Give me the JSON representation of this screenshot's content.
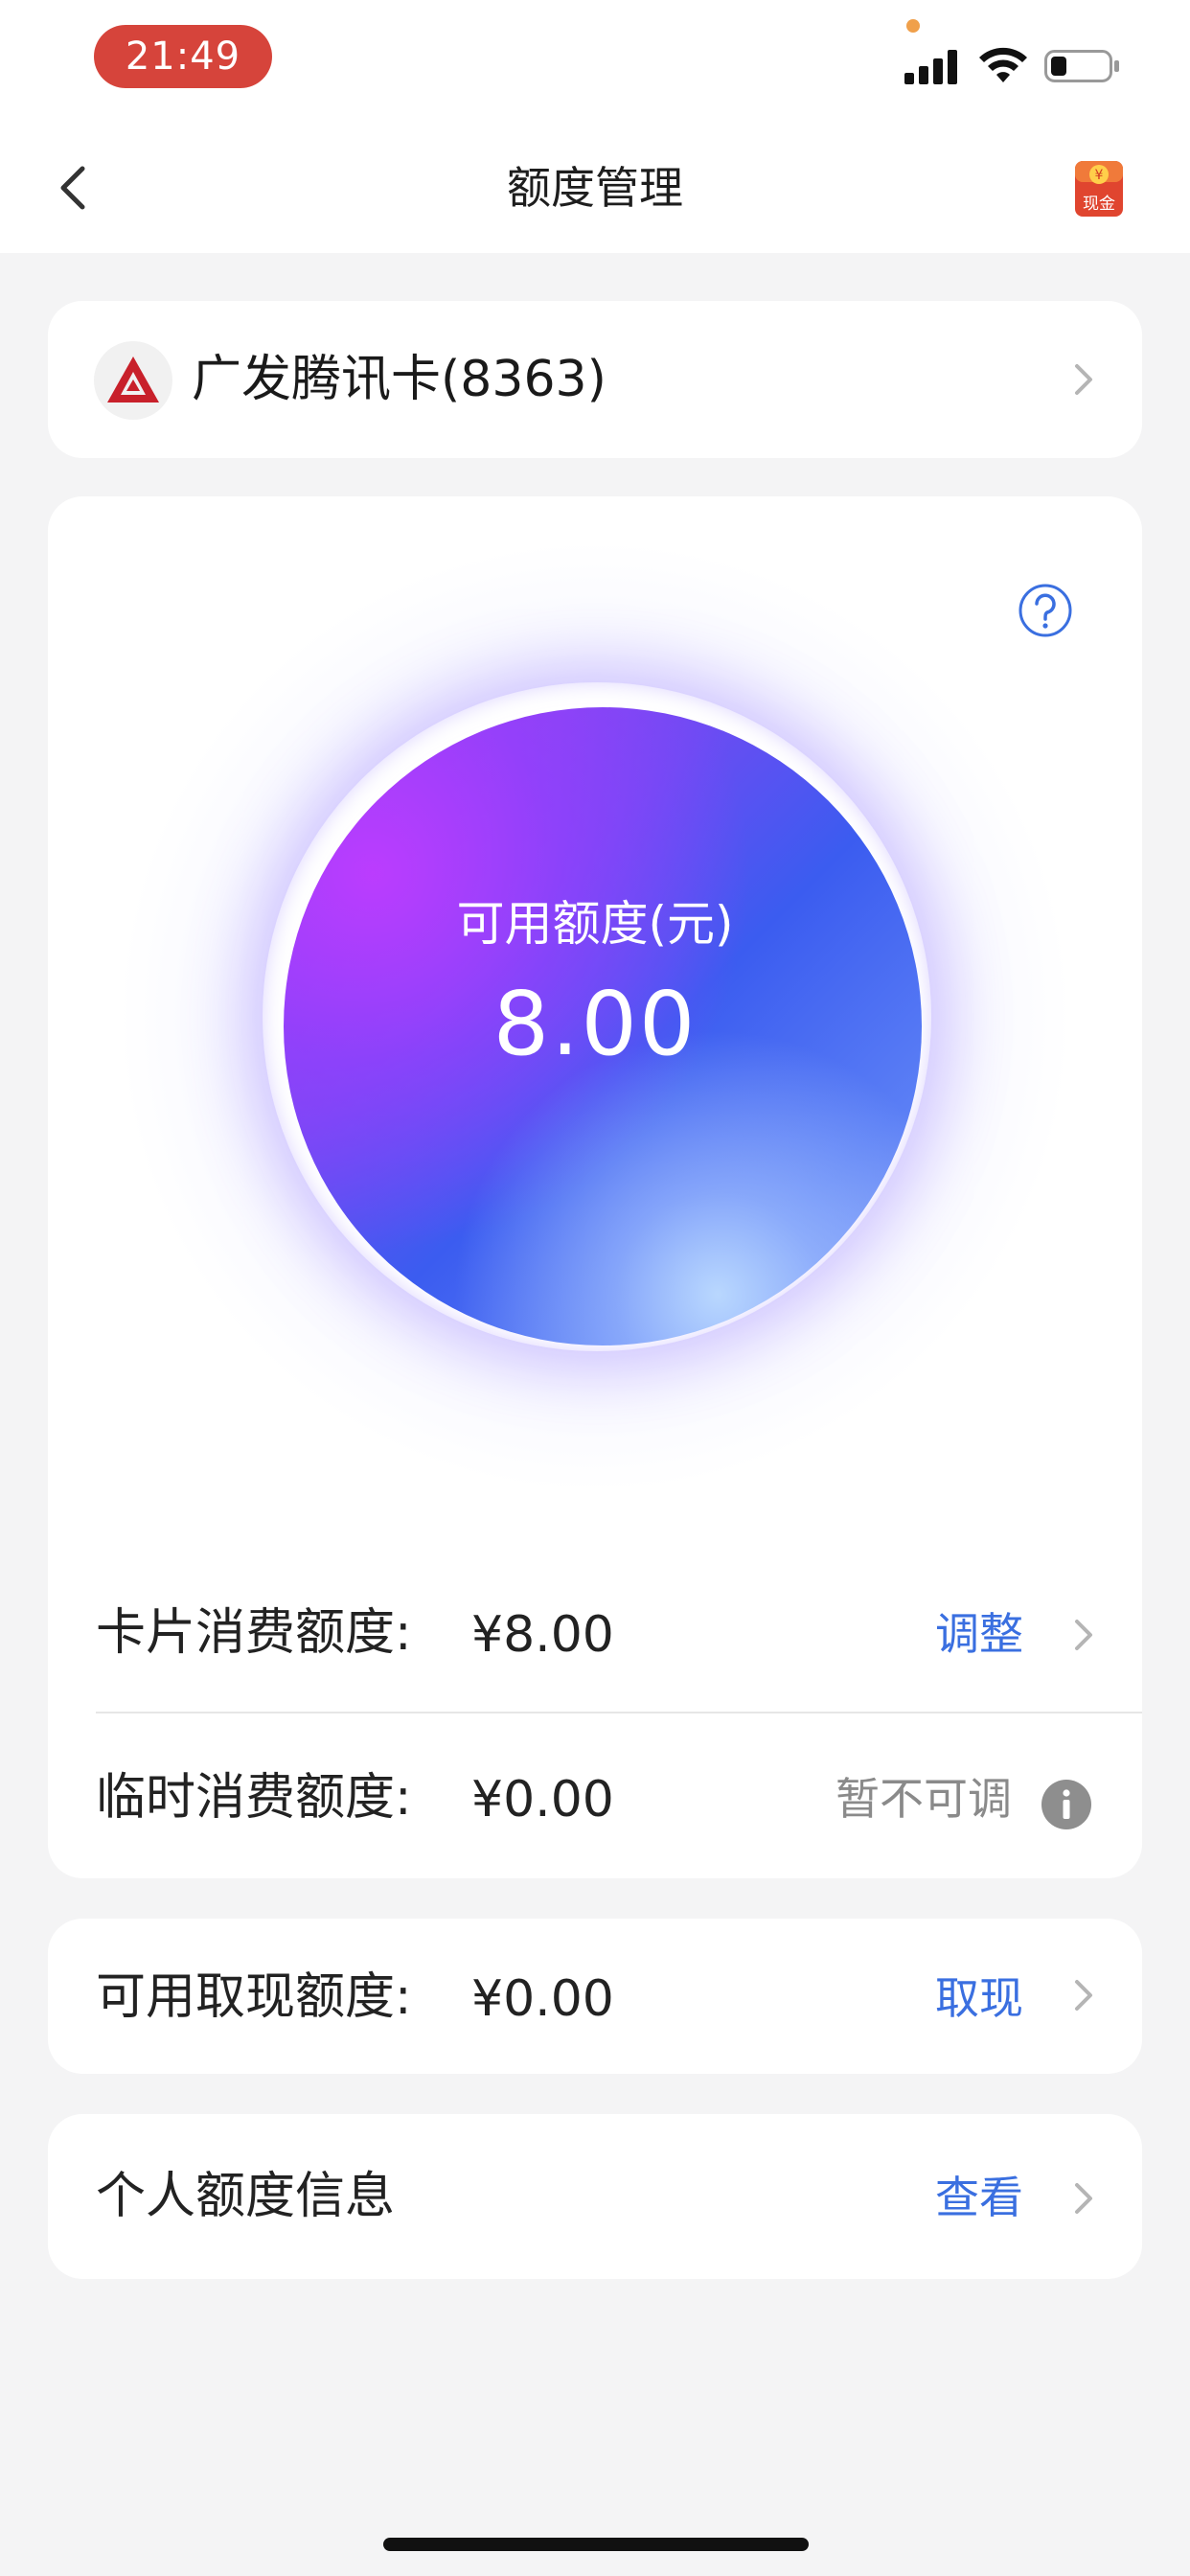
{
  "status_bar": {
    "time": "21:49"
  },
  "nav": {
    "title": "额度管理",
    "cash_badge": "现金"
  },
  "card_select": {
    "name": "广发腾讯卡(8363)"
  },
  "orb": {
    "label": "可用额度(元)",
    "value": "8.00"
  },
  "limits": {
    "card_spending": {
      "label": "卡片消费额度:",
      "value": "¥8.00",
      "action": "调整"
    },
    "temporary": {
      "label": "临时消费额度:",
      "value": "¥0.00",
      "action": "暂不可调"
    }
  },
  "cash": {
    "label": "可用取现额度:",
    "value": "¥0.00",
    "action": "取现"
  },
  "personal": {
    "label": "个人额度信息",
    "action": "查看"
  },
  "colors": {
    "accent": "#3a6fe0",
    "status_pill": "#d6443b",
    "background": "#f4f4f5"
  },
  "icons": [
    "back-icon",
    "cash-envelope-icon",
    "bank-logo-icon",
    "chevron-right-icon",
    "help-icon",
    "info-icon"
  ]
}
